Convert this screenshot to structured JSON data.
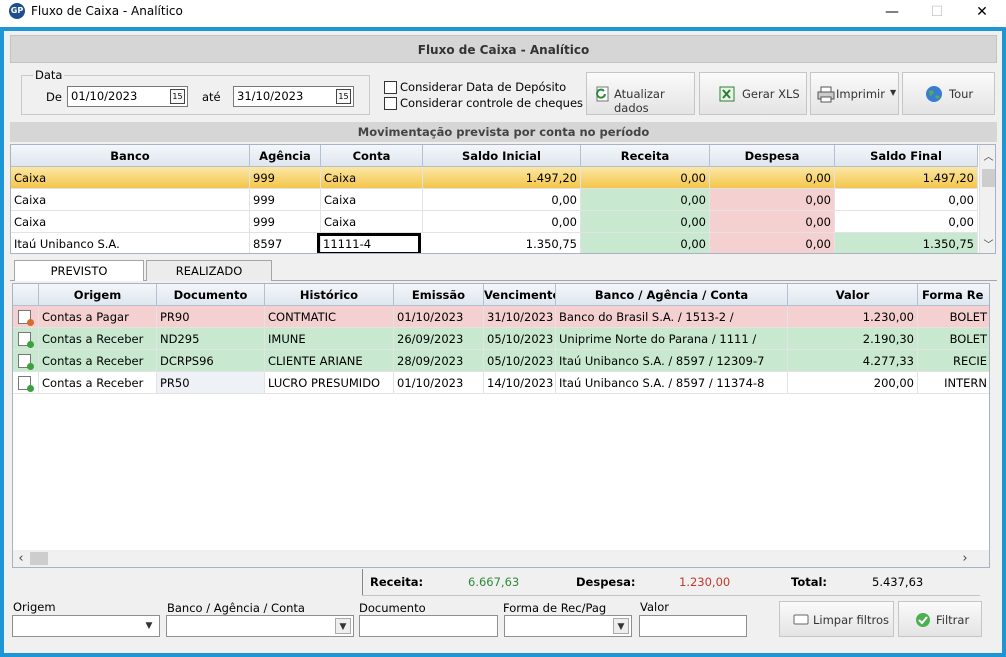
{
  "window": {
    "app_icon": "GP",
    "title": "Fluxo de Caixa - Analítico",
    "minimize": "—",
    "maximize": "☐",
    "close": "✕"
  },
  "header": {
    "title": "Fluxo de Caixa - Analítico"
  },
  "filters": {
    "group_label": "Data",
    "from_label": "De",
    "from_value": "01/10/2023",
    "to_label": "até",
    "to_value": "31/10/2023",
    "calendar_icon": "15",
    "check_deposit": "Considerar Data de Depósito",
    "check_cheques": "Considerar controle de cheques"
  },
  "toolbar": {
    "refresh": "Atualizar dados",
    "xls": "Gerar XLS",
    "print": "Imprimir",
    "tour": "Tour"
  },
  "accounts": {
    "title": "Movimentação prevista por conta no período",
    "columns": [
      "Banco",
      "Agência",
      "Conta",
      "Saldo Inicial",
      "Receita",
      "Despesa",
      "Saldo Final"
    ],
    "rows": [
      [
        "Caixa",
        "999",
        "Caixa",
        "1.497,20",
        "0,00",
        "0,00",
        "1.497,20"
      ],
      [
        "Caixa",
        "999",
        "Caixa",
        "0,00",
        "0,00",
        "0,00",
        "0,00"
      ],
      [
        "Caixa",
        "999",
        "Caixa",
        "0,00",
        "0,00",
        "0,00",
        "0,00"
      ],
      [
        "Itaú Unibanco S.A.",
        "8597",
        "11111-4",
        "1.350,75",
        "0,00",
        "0,00",
        "1.350,75"
      ]
    ]
  },
  "tabs": {
    "previsto": "PREVISTO",
    "realizado": "REALIZADO"
  },
  "movements": {
    "columns": [
      "Origem",
      "Documento",
      "Histórico",
      "Emissão",
      "Vencimento",
      "Banco / Agência / Conta",
      "Valor",
      "Forma Re"
    ],
    "rows": [
      [
        "Contas a Pagar",
        "PR90",
        "CONTMATIC",
        "01/10/2023",
        "31/10/2023",
        "Banco do Brasil S.A. / 1513-2 /",
        "1.230,00",
        "BOLET"
      ],
      [
        "Contas a Receber",
        "ND295",
        "IMUNE",
        "26/09/2023",
        "05/10/2023",
        "Uniprime Norte do Parana / 1111 /",
        "2.190,30",
        "BOLET"
      ],
      [
        "Contas a Receber",
        "DCRPS96",
        "CLIENTE ARIANE",
        "28/09/2023",
        "05/10/2023",
        "Itaú Unibanco S.A. / 8597 / 12309-7",
        "4.277,33",
        "RECIE"
      ],
      [
        "Contas a Receber",
        "PR50",
        "LUCRO PRESUMIDO",
        "01/10/2023",
        "14/10/2023",
        "Itaú Unibanco S.A. / 8597 / 11374-8",
        "200,00",
        "INTERN"
      ]
    ]
  },
  "totals": {
    "receita_label": "Receita:",
    "receita_value": "6.667,63",
    "despesa_label": "Despesa:",
    "despesa_value": "1.230,00",
    "total_label": "Total:",
    "total_value": "5.437,63"
  },
  "bottom_filters": {
    "origem": "Origem",
    "banco": "Banco / Agência / Conta",
    "documento": "Documento",
    "forma": "Forma de Rec/Pag",
    "valor": "Valor",
    "clear": "Limpar filtros",
    "filter": "Filtrar"
  },
  "colors": {
    "frame": "#1e96d6",
    "receita": "#2e8b3a",
    "despesa": "#c0392b",
    "row_green": "#c8e9cf",
    "row_red": "#f4d0d0",
    "selected": "#f4c64a"
  }
}
